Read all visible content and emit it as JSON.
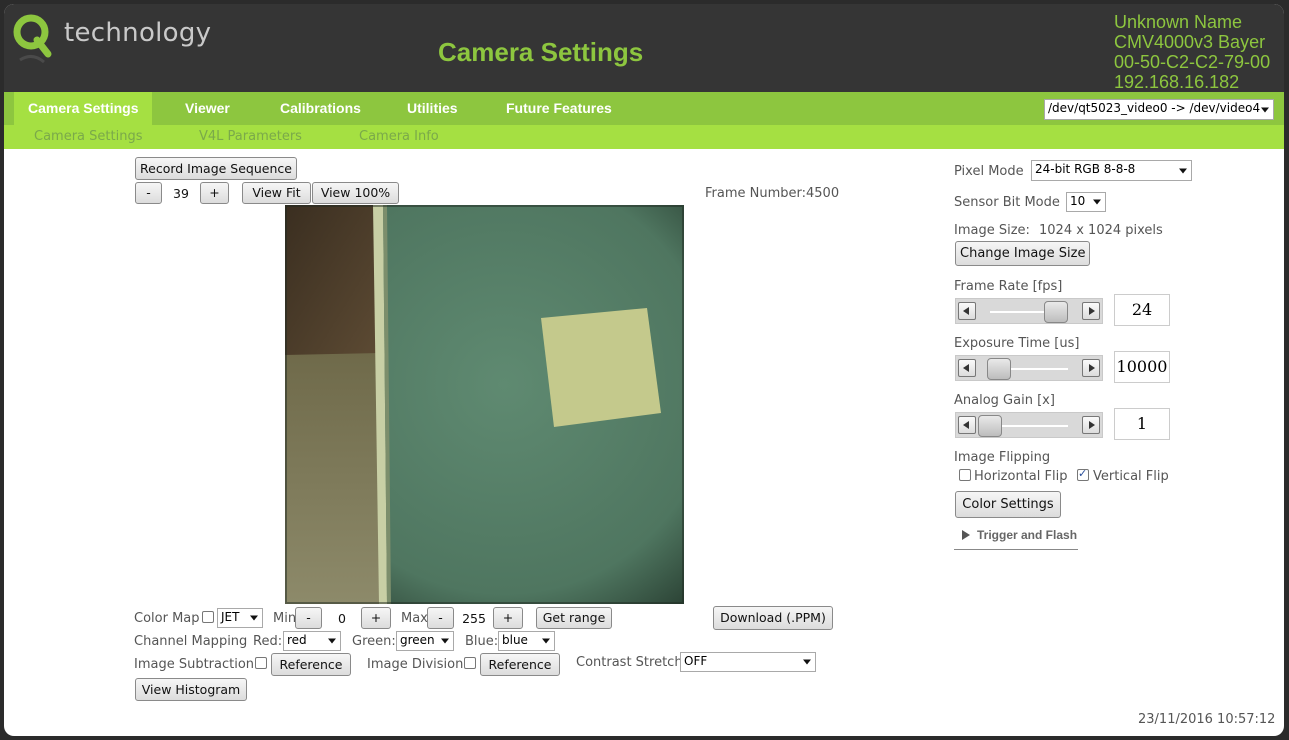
{
  "header": {
    "logo_text": "technology",
    "title": "Camera Settings",
    "device": {
      "name": "Unknown Name",
      "sensor": "CMV4000v3 Bayer",
      "mac": "00-50-C2-C2-79-00",
      "ip": "192.168.16.182"
    }
  },
  "menu": {
    "items": [
      "Camera Settings",
      "Viewer",
      "Calibrations",
      "Utilities",
      "Future Features"
    ],
    "active": "Camera Settings",
    "device_select": "/dev/qt5023_video0 -> /dev/video4"
  },
  "submenu": {
    "items": [
      "Camera Settings",
      "V4L Parameters",
      "Camera Info"
    ]
  },
  "viewer": {
    "record_label": "Record Image Sequence",
    "minus": "-",
    "plus": "+",
    "zoom_value": "39",
    "view_fit_label": "View Fit",
    "view_100_label": "View 100%",
    "frame_number": "Frame Number:4500"
  },
  "bottom": {
    "color_map_label": "Color Map",
    "color_map_value": "JET",
    "min_label": "Min",
    "min_value": "0",
    "max_label": "Max",
    "max_value": "255",
    "get_range_label": "Get range",
    "download_label": "Download (.PPM)",
    "channel_mapping_label": "Channel Mapping",
    "red_label": "Red:",
    "red_value": "red",
    "green_label": "Green:",
    "green_value": "green",
    "blue_label": "Blue:",
    "blue_value": "blue",
    "image_subtraction_label": "Image Subtraction",
    "reference_label": "Reference",
    "image_division_label": "Image Division",
    "contrast_stretch_label": "Contrast Stretch",
    "contrast_stretch_value": "OFF",
    "view_histogram_label": "View Histogram"
  },
  "settings": {
    "pixel_mode_label": "Pixel Mode",
    "pixel_mode_value": "24-bit RGB 8-8-8",
    "sensor_bit_mode_label": "Sensor Bit Mode",
    "sensor_bit_mode_value": "10",
    "image_size_label": "Image Size:",
    "image_size_value": "1024 x 1024 pixels",
    "change_image_size_label": "Change Image Size",
    "frame_rate_label": "Frame Rate [fps]",
    "frame_rate_value": "24",
    "frame_rate_level": 0.85,
    "exposure_label": "Exposure Time [us]",
    "exposure_value": "10000",
    "exposure_level": 0.12,
    "gain_label": "Analog Gain [x]",
    "gain_value": "1",
    "gain_level": 0.0,
    "flipping_label": "Image Flipping",
    "horizontal_flip_label": "Horizontal Flip",
    "horizontal_flip": false,
    "vertical_flip_label": "Vertical Flip",
    "vertical_flip": true,
    "color_settings_label": "Color Settings",
    "trigger_label": "Trigger and Flash"
  },
  "status": {
    "timestamp": "23/11/2016 10:57:12"
  },
  "colors": {
    "brand_green": "#8dc63f",
    "menu_active": "#a5e042",
    "header_bg": "#353535"
  }
}
